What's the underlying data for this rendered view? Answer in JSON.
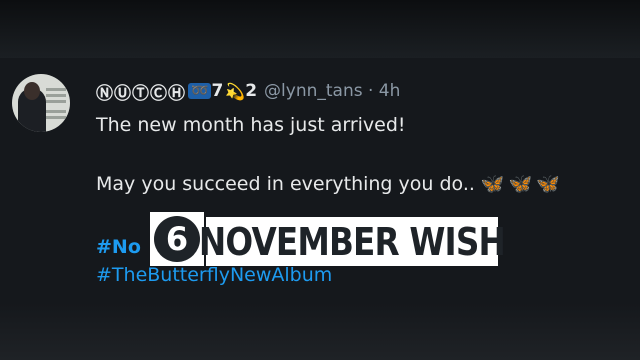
{
  "background_text": "",
  "tweet": {
    "display_name": "ⓃⓊⓉⒸⒽ",
    "badge": "➿",
    "display_suffix_num": "7",
    "star": "💫",
    "display_suffix_end": "2",
    "handle": "@lynn_tans · 4h",
    "line1": "The new month has just arrived!",
    "line2": "May you succeed in everything you do..",
    "butterflies": "🦋🦋🦋",
    "hashtag1": "#No",
    "hashtag2": "#TheButterflyNewAlbum"
  },
  "overlay": {
    "logo_number": "6",
    "banner_text": "NOVEMBER WISH"
  },
  "colors": {
    "background": "#15181c",
    "text": "#e7e9ea",
    "handle": "#8b98a5",
    "link": "#1d9bf0",
    "banner_bg": "#ffffff",
    "banner_text": "#1e2328"
  }
}
